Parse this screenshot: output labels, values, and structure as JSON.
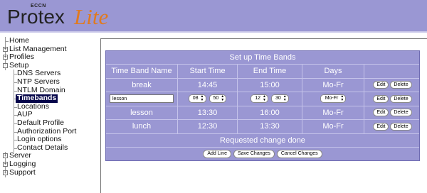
{
  "header": {
    "brand_small": "ECCN",
    "title_part1": "Protex",
    "title_part2": "Lite"
  },
  "sidebar": {
    "items": [
      {
        "label": "Home",
        "level": 0
      },
      {
        "label": "List Management",
        "level": 0,
        "expandable": true
      },
      {
        "label": "Profiles",
        "level": 0,
        "expandable": true
      },
      {
        "label": "Setup",
        "level": 0,
        "expanded": true
      },
      {
        "label": "DNS Servers",
        "level": 1
      },
      {
        "label": "NTP Servers",
        "level": 1
      },
      {
        "label": "NTLM Domain",
        "level": 1
      },
      {
        "label": "Timebands",
        "level": 1,
        "active": true
      },
      {
        "label": "Locations",
        "level": 1
      },
      {
        "label": "AUP",
        "level": 1
      },
      {
        "label": "Default Profile",
        "level": 1
      },
      {
        "label": "Authorization Port",
        "level": 1
      },
      {
        "label": "Login options",
        "level": 1
      },
      {
        "label": "Contact Details",
        "level": 1
      },
      {
        "label": "Server",
        "level": 0,
        "expandable": true
      },
      {
        "label": "Logging",
        "level": 0,
        "expandable": true
      },
      {
        "label": "Support",
        "level": 0,
        "expandable": true
      }
    ]
  },
  "timebands": {
    "title": "Set up Time Bands",
    "columns": [
      "Time Band Name",
      "Start Time",
      "End Time",
      "Days"
    ],
    "rows": [
      {
        "name": "break",
        "start": "14:45",
        "end": "15:00",
        "days": "Mo-Fr"
      },
      {
        "name": "lesson",
        "start": "13:30",
        "end": "16:00",
        "days": "Mo-Fr"
      },
      {
        "name": "lunch",
        "start": "12:30",
        "end": "13:30",
        "days": "Mo-Fr"
      }
    ],
    "edit_row": {
      "name_value": "lesson",
      "start_hour": "08",
      "start_min": "50",
      "end_hour": "12",
      "end_min": "30",
      "days": "Mo-Fr"
    },
    "edit_label": "Edit",
    "delete_label": "Delete",
    "status": "Requested change done",
    "add_line_label": "Add Line",
    "save_changes_label": "Save Changes",
    "cancel_changes_label": "Cancel Changes"
  },
  "colors": {
    "header_bg": "#9a97d3",
    "logo_accent": "#e07a1f",
    "active_nav_bg": "#06064a"
  }
}
